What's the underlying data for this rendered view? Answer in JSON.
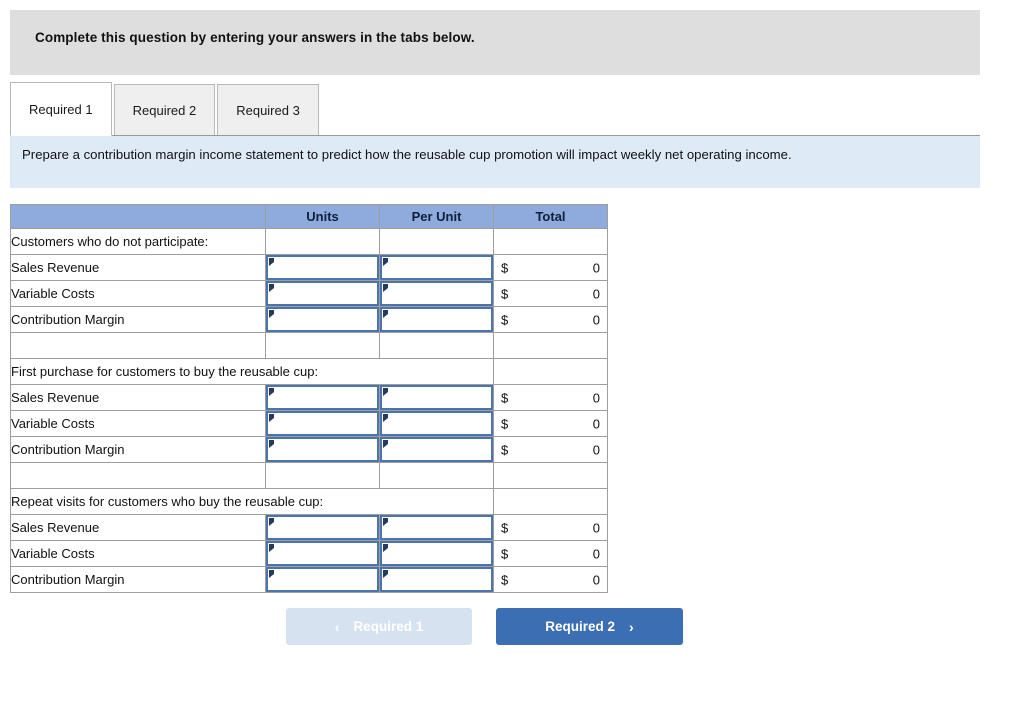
{
  "instruction": {
    "text": "Complete this question by entering your answers in the tabs below."
  },
  "tabs": [
    {
      "label": "Required 1",
      "active": true
    },
    {
      "label": "Required 2",
      "active": false
    },
    {
      "label": "Required 3",
      "active": false
    }
  ],
  "requirement": {
    "text": "Prepare a contribution margin income statement to predict how the reusable cup promotion will impact weekly net operating income."
  },
  "table": {
    "headers": [
      "",
      "Units",
      "Per Unit",
      "Total"
    ],
    "sections": [
      {
        "title": "Customers who do not participate:",
        "title_spans_columns": false,
        "rows": [
          {
            "label": "Sales Revenue",
            "units": "",
            "per_unit": "",
            "currency": "$",
            "total": "0"
          },
          {
            "label": "Variable Costs",
            "units": "",
            "per_unit": "",
            "currency": "$",
            "total": "0"
          },
          {
            "label": "Contribution Margin",
            "units": "",
            "per_unit": "",
            "currency": "$",
            "total": "0"
          }
        ]
      },
      {
        "title": "First purchase for customers to buy the reusable cup:",
        "title_spans_columns": true,
        "rows": [
          {
            "label": "Sales Revenue",
            "units": "",
            "per_unit": "",
            "currency": "$",
            "total": "0"
          },
          {
            "label": "Variable Costs",
            "units": "",
            "per_unit": "",
            "currency": "$",
            "total": "0"
          },
          {
            "label": "Contribution Margin",
            "units": "",
            "per_unit": "",
            "currency": "$",
            "total": "0"
          }
        ]
      },
      {
        "title": "Repeat visits for customers who buy the reusable cup:",
        "title_spans_columns": true,
        "rows": [
          {
            "label": "Sales Revenue",
            "units": "",
            "per_unit": "",
            "currency": "$",
            "total": "0"
          },
          {
            "label": "Variable Costs",
            "units": "",
            "per_unit": "",
            "currency": "$",
            "total": "0"
          },
          {
            "label": "Contribution Margin",
            "units": "",
            "per_unit": "",
            "currency": "$",
            "total": "0"
          }
        ]
      }
    ]
  },
  "navigation": {
    "prev": {
      "label": "Required 1",
      "icon": "chevron-left-icon",
      "glyph": "‹",
      "disabled": true
    },
    "next": {
      "label": "Required 2",
      "icon": "chevron-right-icon",
      "glyph": "›",
      "disabled": false
    }
  },
  "colors": {
    "instruction_banner": "#dedede",
    "requirement_banner": "#deebf7",
    "table_header": "#8faadc",
    "input_border": "#4b74ac",
    "button_active": "#3c6eb4",
    "button_disabled": "#d6e2f0"
  }
}
